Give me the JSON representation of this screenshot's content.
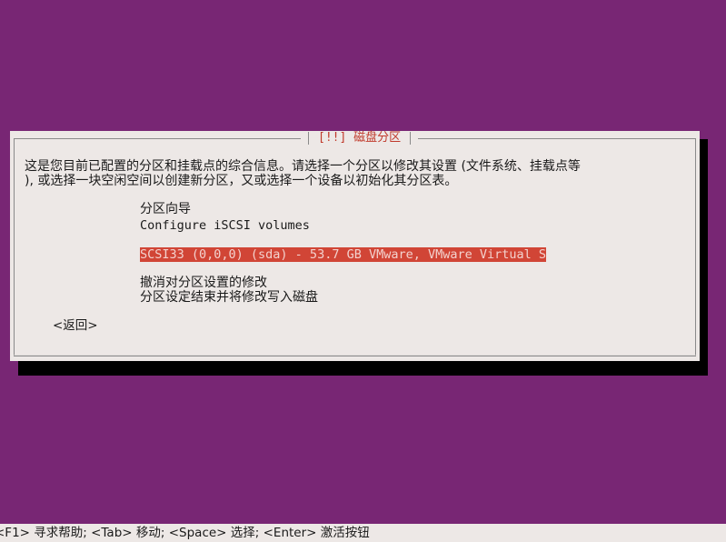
{
  "dialog": {
    "title": "[!!] 磁盘分区",
    "description_line1": "这是您目前已配置的分区和挂载点的综合信息。请选择一个分区以修改其设置 (文件系统、挂载点等",
    "description_line2": "), 或选择一块空闲空间以创建新分区，又或选择一个设备以初始化其分区表。",
    "menu": [
      {
        "label": "分区向导"
      },
      {
        "label": "Configure iSCSI volumes"
      },
      {
        "label": "SCSI33 (0,0,0) (sda) - 53.7 GB VMware, VMware Virtual S",
        "selected": true
      },
      {
        "label": "撤消对分区设置的修改"
      },
      {
        "label": "分区设定结束并将修改写入磁盘"
      }
    ],
    "back_button": "<返回>"
  },
  "statusbar": {
    "text": "<F1> 寻求帮助; <Tab> 移动; <Space> 选择; <Enter> 激活按钮"
  },
  "colors": {
    "background": "#782674",
    "dialog": "#ede8e6",
    "title": "#c0392b",
    "selection": "#d14536",
    "shadow": "#000000"
  }
}
